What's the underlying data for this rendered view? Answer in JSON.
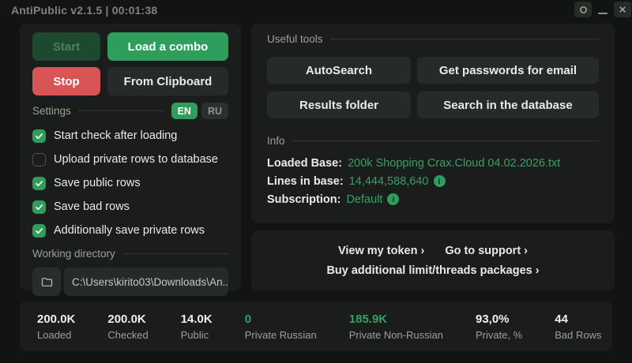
{
  "window": {
    "title": "AntiPublic v2.1.5 | 00:01:38"
  },
  "left_panel": {
    "buttons": {
      "start": "Start",
      "load_combo": "Load a combo",
      "stop": "Stop",
      "from_clipboard": "From Clipboard"
    },
    "settings": {
      "label": "Settings",
      "lang_en": "EN",
      "lang_ru": "RU",
      "checkboxes": [
        {
          "label": "Start check after loading",
          "checked": true
        },
        {
          "label": "Upload private rows to database",
          "checked": false
        },
        {
          "label": "Save public rows",
          "checked": true
        },
        {
          "label": "Save bad rows",
          "checked": true
        },
        {
          "label": "Additionally save private rows",
          "checked": true
        }
      ]
    },
    "working_directory": {
      "label": "Working directory",
      "path": "C:\\Users\\kirito03\\Downloads\\An..."
    }
  },
  "right_panel": {
    "useful_tools": {
      "label": "Useful tools",
      "buttons": [
        "AutoSearch",
        "Get passwords for email",
        "Results folder",
        "Search in the database"
      ]
    },
    "info": {
      "label": "Info",
      "rows": [
        {
          "label": "Loaded Base:",
          "value": "200k Shopping Crax.Cloud 04.02.2026.txt",
          "info_icon": false
        },
        {
          "label": "Lines in base:",
          "value": "14,444,588,640",
          "info_icon": true
        },
        {
          "label": "Subscription:",
          "value": "Default",
          "info_icon": true
        }
      ]
    },
    "links": {
      "view_token": "View my token ›",
      "support": "Go to support ›",
      "buy": "Buy additional limit/threads packages ›"
    }
  },
  "stats": [
    {
      "value": "200.0K",
      "label": "Loaded",
      "green": false
    },
    {
      "value": "200.0K",
      "label": "Checked",
      "green": false
    },
    {
      "value": "14.0K",
      "label": "Public",
      "green": false
    },
    {
      "value": "0",
      "label": "Private Russian",
      "green": true
    },
    {
      "value": "185.9K",
      "label": "Private Non-Russian",
      "green": true
    },
    {
      "value": "93,0%",
      "label": "Private, %",
      "green": false
    },
    {
      "value": "44",
      "label": "Bad Rows",
      "green": false
    }
  ],
  "colors": {
    "background": "#121413",
    "card": "#1a1d1b",
    "button_dark": "#262a28",
    "accent_green": "#2f9e5c",
    "value_green": "#34a169",
    "danger_red": "#d95454",
    "disabled_green_bg": "#1d4a2f",
    "text_primary": "#e9ebe8",
    "text_muted": "#9aa09c"
  }
}
